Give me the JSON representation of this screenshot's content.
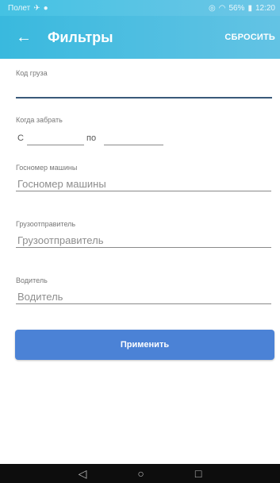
{
  "status_bar": {
    "carrier": "Полет",
    "battery": "56%",
    "time": "12:20"
  },
  "app_bar": {
    "title": "Фильтры",
    "reset_label": "СБРОСИТЬ"
  },
  "form": {
    "cargo_code": {
      "label": "Код груза",
      "value": "",
      "placeholder": ""
    },
    "pickup": {
      "label": "Когда забрать",
      "from_label": "С",
      "to_label": "по",
      "from_value": "",
      "to_value": ""
    },
    "plate": {
      "label": "Госномер машины",
      "placeholder": "Госномер машины"
    },
    "shipper": {
      "label": "Грузоотправитель",
      "placeholder": "Грузоотправитель"
    },
    "driver": {
      "label": "Водитель",
      "placeholder": "Водитель"
    }
  },
  "apply_label": "Применить",
  "nav": {
    "back": "◁",
    "home": "○",
    "recents": "□"
  },
  "colors": {
    "app_bar": "#39b9de",
    "apply_button": "#4b82d6"
  },
  "icons": [
    "airplane-mode-icon",
    "notification-icon",
    "location-icon",
    "wifi-icon",
    "battery-icon",
    "back-arrow-icon"
  ]
}
